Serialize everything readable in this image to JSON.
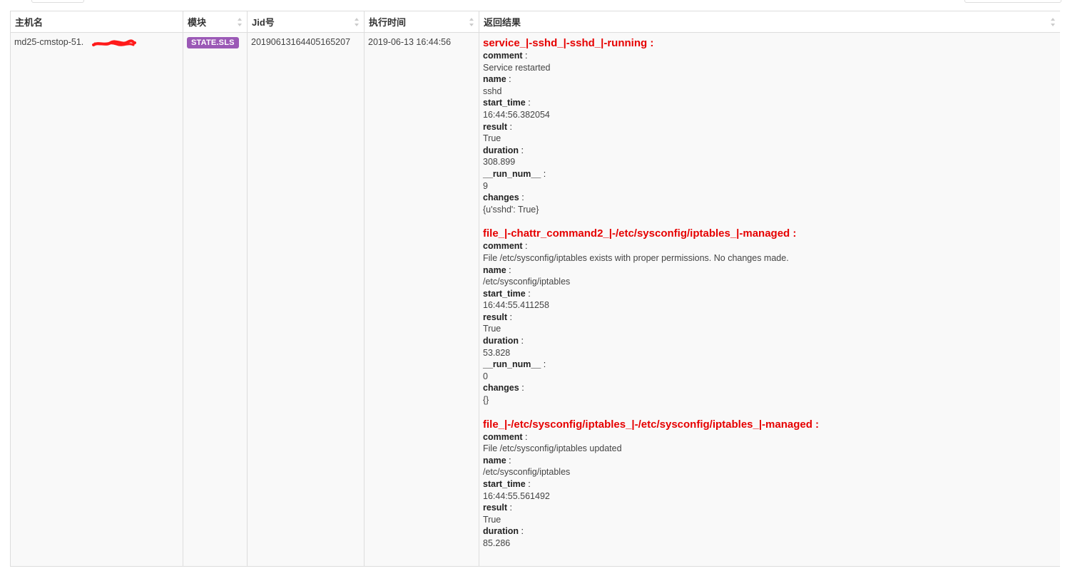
{
  "table": {
    "headers": {
      "host": "主机名",
      "module": "模块",
      "jid": "Jid号",
      "exec_time": "执行时间",
      "result": "返回结果"
    },
    "row": {
      "host": "md25-cmstop-51.",
      "module": "STATE.SLS",
      "jid": "20190613164405165207",
      "exec_time": "2019-06-13 16:44:56"
    }
  },
  "results": [
    {
      "title": "service_|-sshd_|-sshd_|-running :",
      "fields": [
        {
          "key": "comment",
          "value": "Service restarted"
        },
        {
          "key": "name",
          "value": "sshd"
        },
        {
          "key": "start_time",
          "value": "16:44:56.382054"
        },
        {
          "key": "result",
          "value": "True"
        },
        {
          "key": "duration",
          "value": "308.899"
        },
        {
          "key": "__run_num__",
          "value": "9"
        },
        {
          "key": "changes",
          "value": "{u'sshd': True}"
        }
      ]
    },
    {
      "title": "file_|-chattr_command2_|-/etc/sysconfig/iptables_|-managed :",
      "fields": [
        {
          "key": "comment",
          "value": "File /etc/sysconfig/iptables exists with proper permissions. No changes made."
        },
        {
          "key": "name",
          "value": "/etc/sysconfig/iptables"
        },
        {
          "key": "start_time",
          "value": "16:44:55.411258"
        },
        {
          "key": "result",
          "value": "True"
        },
        {
          "key": "duration",
          "value": "53.828"
        },
        {
          "key": "__run_num__",
          "value": "0"
        },
        {
          "key": "changes",
          "value": "{}"
        }
      ]
    },
    {
      "title": "file_|-/etc/sysconfig/iptables_|-/etc/sysconfig/iptables_|-managed :",
      "fields": [
        {
          "key": "comment",
          "value": "File /etc/sysconfig/iptables updated"
        },
        {
          "key": "name",
          "value": "/etc/sysconfig/iptables"
        },
        {
          "key": "start_time",
          "value": "16:44:55.561492"
        },
        {
          "key": "result",
          "value": "True"
        },
        {
          "key": "duration",
          "value": "85.286"
        }
      ]
    }
  ],
  "colors": {
    "title_red": "#e60000",
    "badge_purple": "#9b59b6",
    "border": "#dddddd",
    "row_bg": "#f9f9f9",
    "redaction": "#ff1a1a"
  },
  "icons": {
    "sort": "sort-both-icon",
    "redaction": "redaction-scribble"
  }
}
